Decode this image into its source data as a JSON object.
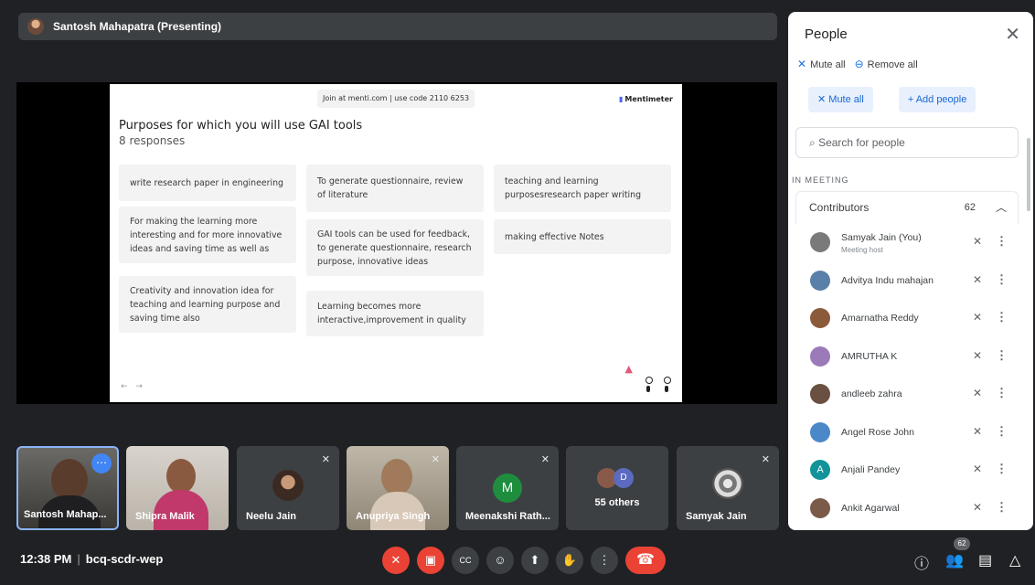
{
  "presenter": {
    "label": "Santosh Mahapatra (Presenting)"
  },
  "slide": {
    "join_text": "Join at menti.com | use code  2110 6253",
    "brand": "Mentimeter",
    "title": "Purposes for which you will use GAI tools",
    "subtitle": "8 responses",
    "responses": [
      "write research paper in engineering",
      "For making the learning more interesting and for more innovative ideas and saving time as well as",
      "Creativity and innovation idea for teaching and learning purpose and saving time also",
      "To generate questionnaire, review of literature",
      "GAI tools can be used for feedback, to generate questionnaire, research purpose, innovative ideas",
      "Learning becomes more interactive,improvement in quality",
      "teaching and learning purposesresearch paper writing",
      "making effective Notes"
    ],
    "nav": "← →"
  },
  "tiles": [
    {
      "name": "Santosh Mahap..."
    },
    {
      "name": "Shipra Malik"
    },
    {
      "name": "Neelu Jain"
    },
    {
      "name": "Anupriya Singh"
    },
    {
      "name": "Meenakshi Rath...",
      "initial": "M"
    },
    {
      "name": "55 others",
      "initial": "D"
    },
    {
      "name": "Samyak Jain"
    }
  ],
  "bottom": {
    "time": "12:38 PM",
    "meeting_code": "bcq-scdr-wep",
    "people_count": "62"
  },
  "panel": {
    "title": "People",
    "mute_all_header": "Mute all",
    "remove_all": "Remove all",
    "mute_all_button": "Mute all",
    "add_people": "Add people",
    "search_placeholder": "Search for people",
    "in_meeting": "IN MEETING",
    "contributors_label": "Contributors",
    "contributors_count": "62",
    "people": [
      {
        "name": "Samyak Jain (You)",
        "role": "Meeting host",
        "color": "#7a7a7a"
      },
      {
        "name": "Advitya Indu mahajan",
        "color": "#5a7fa8"
      },
      {
        "name": "Amarnatha Reddy",
        "color": "#8a5a3a"
      },
      {
        "name": "AMRUTHA K",
        "color": "#9a7ab8"
      },
      {
        "name": "andleeb zahra",
        "color": "#6a5040"
      },
      {
        "name": "Angel Rose John",
        "color": "#4a88c8"
      },
      {
        "name": "Anjali Pandey",
        "initial": "A",
        "color": "#12939a"
      },
      {
        "name": "Ankit Agarwal",
        "color": "#7a5a48"
      }
    ]
  },
  "colors": {
    "accent": "#1a73e8",
    "danger": "#ea4335",
    "meet_bg": "#202124"
  }
}
